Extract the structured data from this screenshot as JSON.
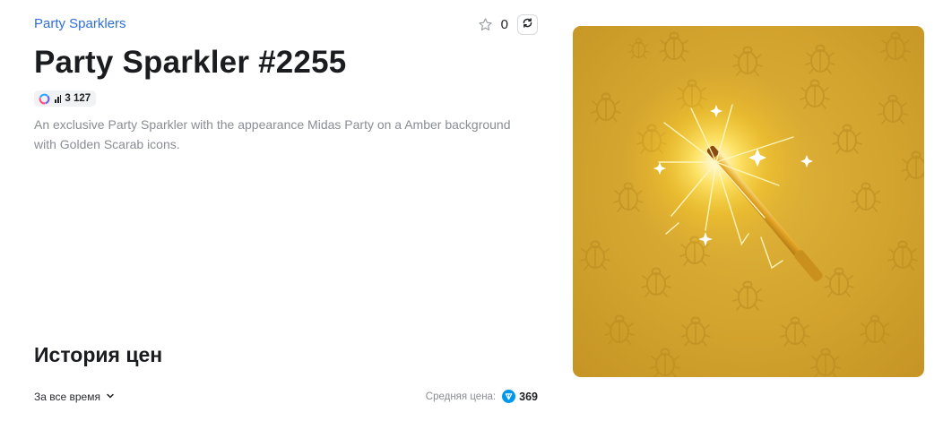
{
  "header": {
    "collection_link": "Party Sparklers",
    "favorites_count": "0"
  },
  "item": {
    "title": "Party Sparkler #2255",
    "stat_value": "3 127",
    "description": "An exclusive Party Sparkler with the appearance Midas Party on a Amber background with Golden Scarab icons."
  },
  "history": {
    "title": "История цен",
    "period_label": "За все время",
    "avg_label": "Средняя цена:",
    "avg_value": "369"
  },
  "colors": {
    "link": "#2f6fd6",
    "ton_badge": "#0098ea",
    "amber_background": "#d3a42e"
  },
  "icons": [
    "star-icon",
    "refresh-icon",
    "chevron-down-icon",
    "ton-icon",
    "bars-icon"
  ]
}
